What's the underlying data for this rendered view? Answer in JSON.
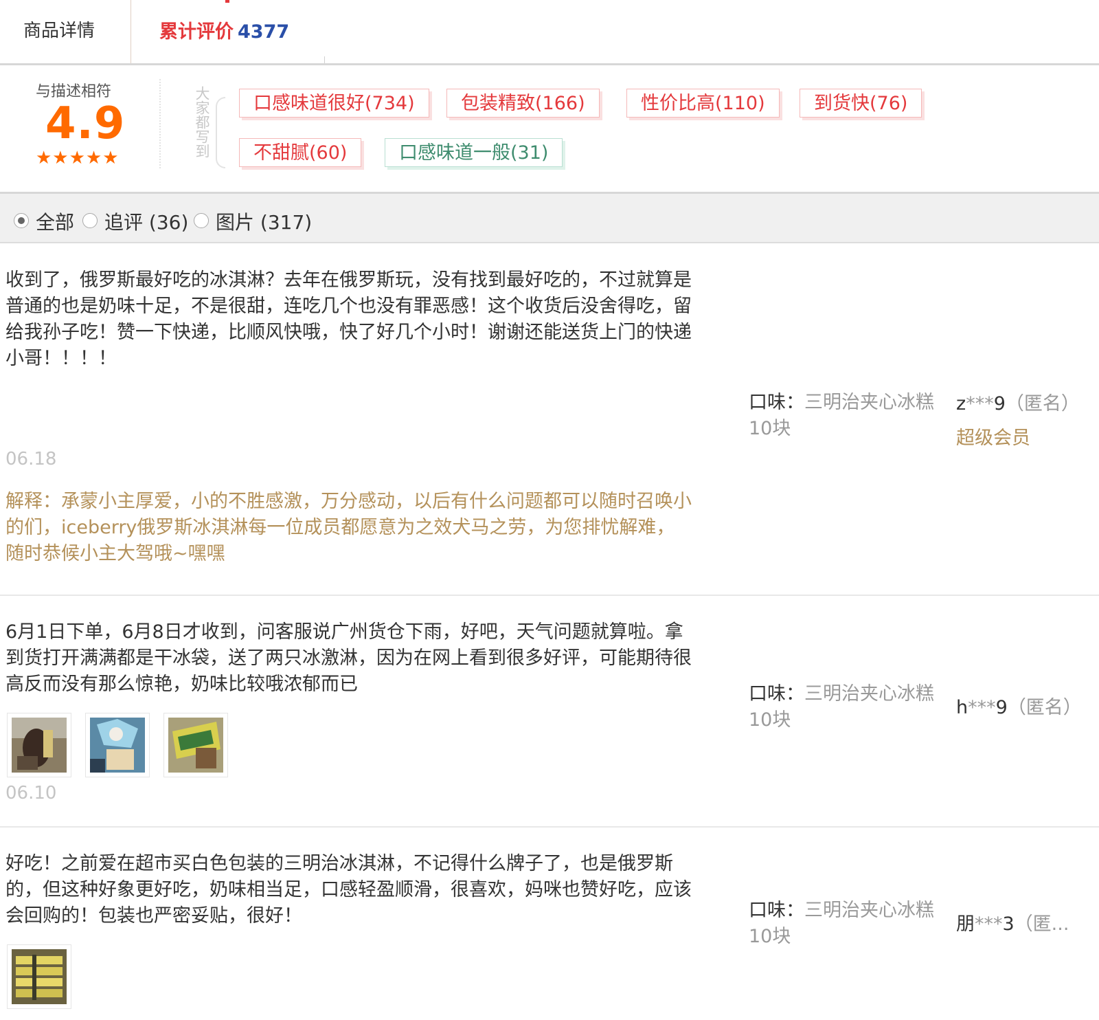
{
  "tabs": {
    "detail_label": "商品详情",
    "reviews_label": "累计评价",
    "reviews_count": "4377"
  },
  "rating": {
    "label": "与描述相符",
    "score": "4.9",
    "stars": "★★★★★",
    "tags_heading": "大家都写到"
  },
  "tags": [
    {
      "text": "口感味道很好(734)",
      "sentiment": "positive"
    },
    {
      "text": "包装精致(166)",
      "sentiment": "positive"
    },
    {
      "text": "性价比高(110)",
      "sentiment": "positive"
    },
    {
      "text": "到货快(76)",
      "sentiment": "positive"
    },
    {
      "text": "不甜腻(60)",
      "sentiment": "positive"
    },
    {
      "text": "口感味道一般(31)",
      "sentiment": "neutral"
    }
  ],
  "filters": [
    {
      "label": "全部",
      "checked": true
    },
    {
      "label": "追评 (36)",
      "checked": false
    },
    {
      "label": "图片 (317)",
      "checked": false
    }
  ],
  "reviews": [
    {
      "text": "收到了，俄罗斯最好吃的冰淇淋？去年在俄罗斯玩，没有找到最好吃的，不过就算是普通的也是奶味十足，不是很甜，连吃几个也没有罪恶感！这个收货后没舍得吃，留给我孙子吃！赞一下快递，比顺风快哦，快了好几个小时！谢谢还能送货上门的快递小哥！！！！",
      "date": "06.18",
      "reply": "解释：承蒙小主厚爱，小的不胜感激，万分感动，以后有什么问题都可以随时召唤小的们，iceberry俄罗斯冰淇淋每一位成员都愿意为之效犬马之劳，为您排忧解难，随时恭候小主大驾哦~嘿嘿",
      "flavor_label": "口味：",
      "flavor_value": "三明治夹心冰糕10块",
      "user_prefix": "z",
      "user_mask": "***",
      "user_suffix": "9",
      "anon": "（匿名）",
      "member": "超级会员"
    },
    {
      "text": "6月1日下单，6月8日才收到，问客服说广州货仓下雨，好吧，天气问题就算啦。拿到货打开满满都是干冰袋，送了两只冰激淋，因为在网上看到很多好评，可能期待很高反而没有那么惊艳，奶味比较哦浓郁而已",
      "date": "06.10",
      "flavor_label": "口味：",
      "flavor_value": "三明治夹心冰糕10块",
      "user_prefix": "h",
      "user_mask": "***",
      "user_suffix": "9",
      "anon": "（匿名）",
      "photos": [
        "ice-cream-bar-photo",
        "ice-cream-packaging-photo",
        "ice-cream-wrapper-photo"
      ]
    },
    {
      "text": "好吃！之前爱在超市买白色包装的三明治冰淇淋，不记得什么牌子了，也是俄罗斯的，但这种好象更好吃，奶味相当足，口感轻盈顺滑，很喜欢，妈咪也赞好吃，应该会回购的！包装也严密妥贴，很好！",
      "flavor_label": "口味：",
      "flavor_value": "三明治夹心冰糕10块",
      "user_prefix": "朋",
      "user_mask": "***",
      "user_suffix": "3",
      "anon": "（匿...",
      "photos": [
        "ice-cream-box-photo"
      ]
    }
  ]
}
